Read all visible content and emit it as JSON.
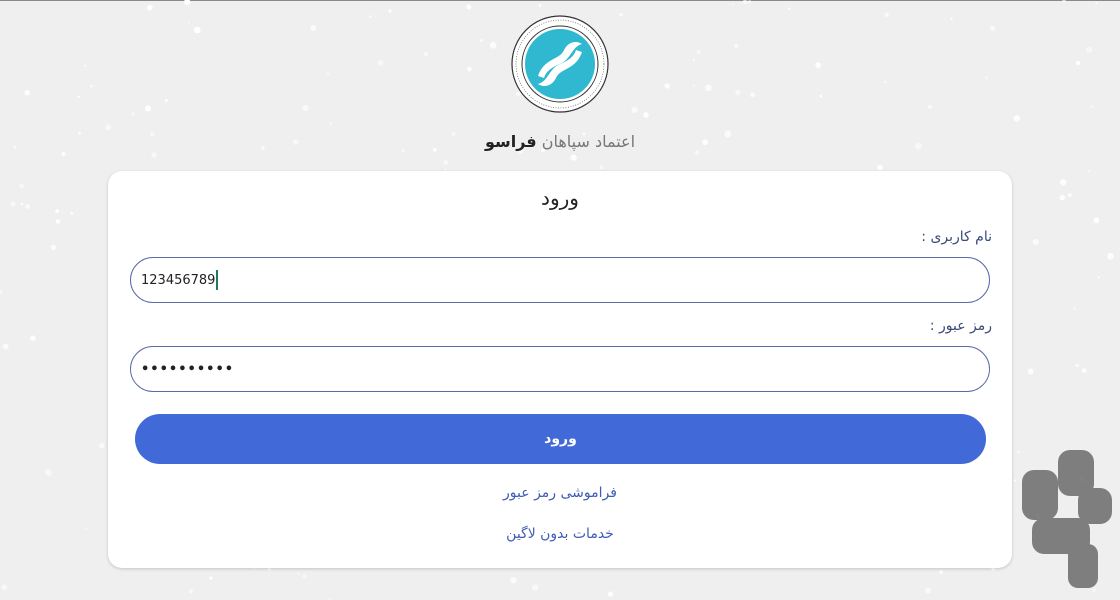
{
  "brand": {
    "prefix": "اعتماد سپاهان",
    "name": "فراسو"
  },
  "login": {
    "title": "ورود",
    "username_label": "نام کاربری :",
    "username_value": "123456789",
    "password_label": "رمز عبور :",
    "password_value": "••••••••••",
    "submit_label": "ورود",
    "forgot_link": "فراموشی رمز عبور",
    "guest_link": "خدمات بدون لاگین"
  },
  "colors": {
    "accent": "#4169d8",
    "link": "#3f5bb8",
    "field_border": "#5b6aa8",
    "logo_teal": "#2fb8d0"
  },
  "icons": {
    "logo": "company-logo",
    "watermark": "bazaar-watermark-icon"
  }
}
